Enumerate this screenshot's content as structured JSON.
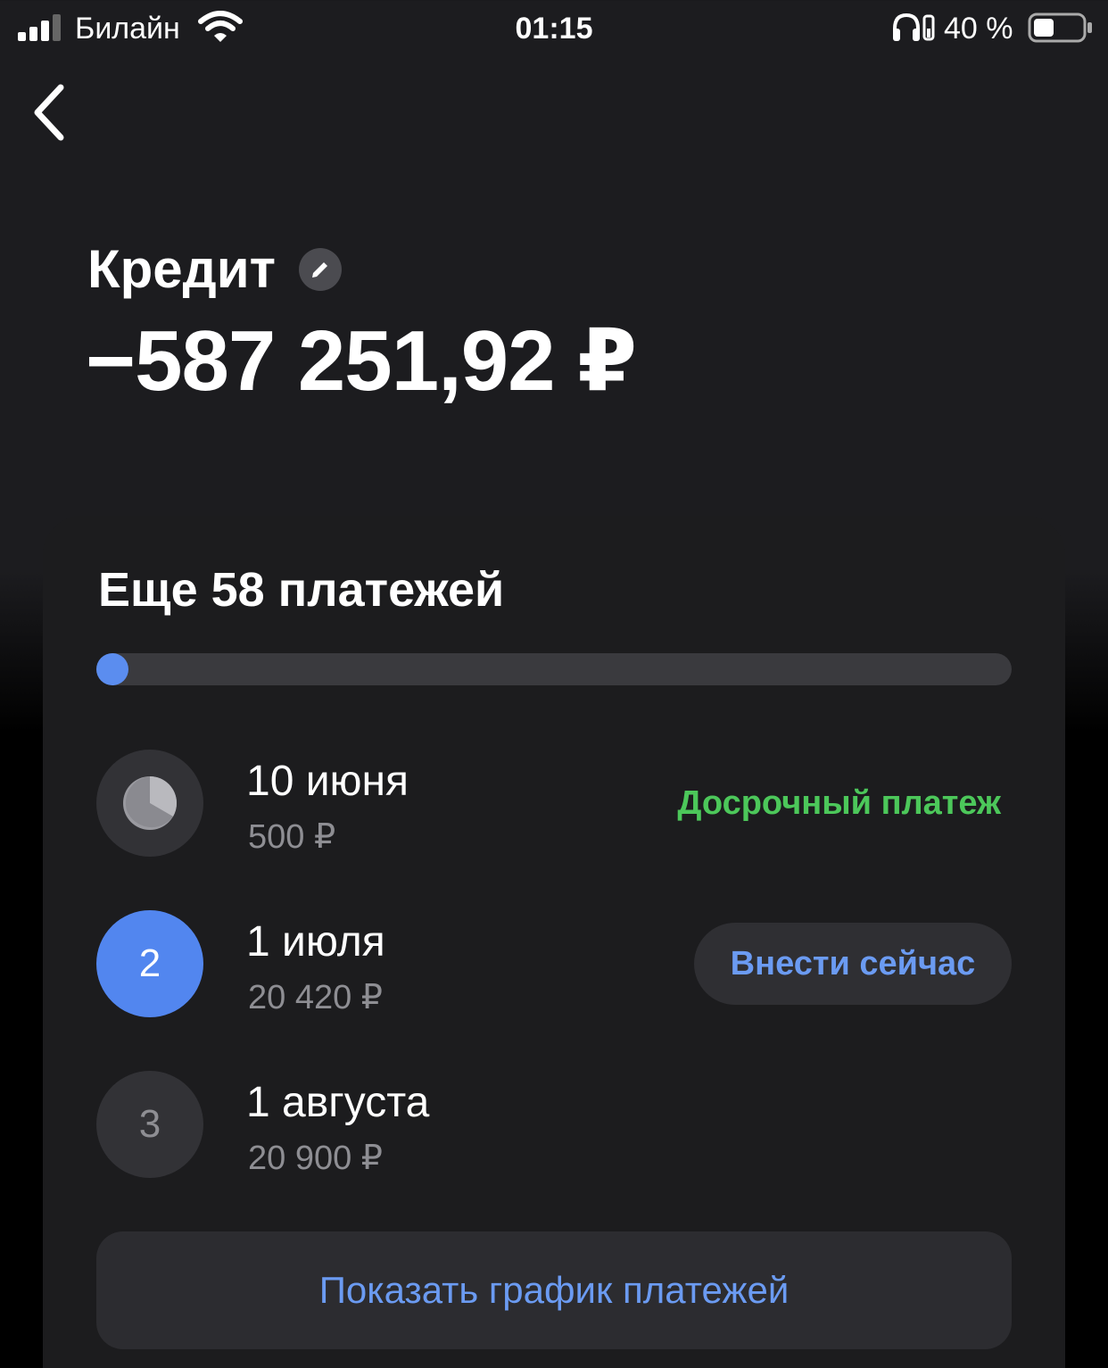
{
  "status_bar": {
    "carrier": "Билайн",
    "time": "01:15",
    "battery_text": "40 %",
    "icons": [
      "signal-icon",
      "wifi-icon",
      "headphones-icon",
      "battery-icon"
    ]
  },
  "header": {
    "back_icon": "chevron-left-icon",
    "title": "Кредит",
    "edit_icon": "pencil-icon",
    "balance": "−587 251,92 ₽"
  },
  "payments": {
    "title": "Еще 58 платежей",
    "progress": 0.02,
    "items": [
      {
        "date": "10 июня",
        "amount": "500 ₽",
        "icon": "pie-clock-icon",
        "label": "Досрочный платеж"
      },
      {
        "number": "2",
        "date": "1 июля",
        "amount": "20 420 ₽",
        "action": "Внести сейчас"
      },
      {
        "number": "3",
        "date": "1 августа",
        "amount": "20 900 ₽"
      }
    ],
    "schedule_button": "Показать график платежей"
  },
  "colors": {
    "accent": "#5286ef",
    "link": "#6b9bf2",
    "success": "#4cc75a",
    "card": "#1c1c1e"
  }
}
